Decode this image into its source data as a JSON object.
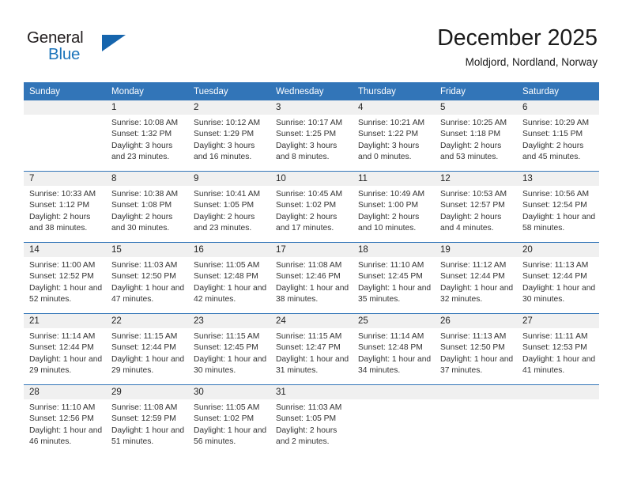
{
  "brand": {
    "name_part1": "General",
    "name_part2": "Blue",
    "accent_color": "#1c74bb",
    "triangle_color": "#1665ad"
  },
  "header": {
    "title": "December 2025",
    "subtitle": "Moldjord, Nordland, Norway"
  },
  "calendar": {
    "header_bg": "#3275b8",
    "weekday_headers": [
      "Sunday",
      "Monday",
      "Tuesday",
      "Wednesday",
      "Thursday",
      "Friday",
      "Saturday"
    ],
    "weeks": [
      [
        {
          "day": "",
          "lines": []
        },
        {
          "day": "1",
          "lines": [
            "Sunrise: 10:08 AM",
            "Sunset: 1:32 PM",
            "Daylight: 3 hours",
            "and 23 minutes."
          ]
        },
        {
          "day": "2",
          "lines": [
            "Sunrise: 10:12 AM",
            "Sunset: 1:29 PM",
            "Daylight: 3 hours",
            "and 16 minutes."
          ]
        },
        {
          "day": "3",
          "lines": [
            "Sunrise: 10:17 AM",
            "Sunset: 1:25 PM",
            "Daylight: 3 hours",
            "and 8 minutes."
          ]
        },
        {
          "day": "4",
          "lines": [
            "Sunrise: 10:21 AM",
            "Sunset: 1:22 PM",
            "Daylight: 3 hours",
            "and 0 minutes."
          ]
        },
        {
          "day": "5",
          "lines": [
            "Sunrise: 10:25 AM",
            "Sunset: 1:18 PM",
            "Daylight: 2 hours",
            "and 53 minutes."
          ]
        },
        {
          "day": "6",
          "lines": [
            "Sunrise: 10:29 AM",
            "Sunset: 1:15 PM",
            "Daylight: 2 hours",
            "and 45 minutes."
          ]
        }
      ],
      [
        {
          "day": "7",
          "lines": [
            "Sunrise: 10:33 AM",
            "Sunset: 1:12 PM",
            "Daylight: 2 hours",
            "and 38 minutes."
          ]
        },
        {
          "day": "8",
          "lines": [
            "Sunrise: 10:38 AM",
            "Sunset: 1:08 PM",
            "Daylight: 2 hours",
            "and 30 minutes."
          ]
        },
        {
          "day": "9",
          "lines": [
            "Sunrise: 10:41 AM",
            "Sunset: 1:05 PM",
            "Daylight: 2 hours",
            "and 23 minutes."
          ]
        },
        {
          "day": "10",
          "lines": [
            "Sunrise: 10:45 AM",
            "Sunset: 1:02 PM",
            "Daylight: 2 hours",
            "and 17 minutes."
          ]
        },
        {
          "day": "11",
          "lines": [
            "Sunrise: 10:49 AM",
            "Sunset: 1:00 PM",
            "Daylight: 2 hours",
            "and 10 minutes."
          ]
        },
        {
          "day": "12",
          "lines": [
            "Sunrise: 10:53 AM",
            "Sunset: 12:57 PM",
            "Daylight: 2 hours",
            "and 4 minutes."
          ]
        },
        {
          "day": "13",
          "lines": [
            "Sunrise: 10:56 AM",
            "Sunset: 12:54 PM",
            "Daylight: 1 hour and",
            "58 minutes."
          ]
        }
      ],
      [
        {
          "day": "14",
          "lines": [
            "Sunrise: 11:00 AM",
            "Sunset: 12:52 PM",
            "Daylight: 1 hour and",
            "52 minutes."
          ]
        },
        {
          "day": "15",
          "lines": [
            "Sunrise: 11:03 AM",
            "Sunset: 12:50 PM",
            "Daylight: 1 hour and",
            "47 minutes."
          ]
        },
        {
          "day": "16",
          "lines": [
            "Sunrise: 11:05 AM",
            "Sunset: 12:48 PM",
            "Daylight: 1 hour and",
            "42 minutes."
          ]
        },
        {
          "day": "17",
          "lines": [
            "Sunrise: 11:08 AM",
            "Sunset: 12:46 PM",
            "Daylight: 1 hour and",
            "38 minutes."
          ]
        },
        {
          "day": "18",
          "lines": [
            "Sunrise: 11:10 AM",
            "Sunset: 12:45 PM",
            "Daylight: 1 hour and",
            "35 minutes."
          ]
        },
        {
          "day": "19",
          "lines": [
            "Sunrise: 11:12 AM",
            "Sunset: 12:44 PM",
            "Daylight: 1 hour and",
            "32 minutes."
          ]
        },
        {
          "day": "20",
          "lines": [
            "Sunrise: 11:13 AM",
            "Sunset: 12:44 PM",
            "Daylight: 1 hour and",
            "30 minutes."
          ]
        }
      ],
      [
        {
          "day": "21",
          "lines": [
            "Sunrise: 11:14 AM",
            "Sunset: 12:44 PM",
            "Daylight: 1 hour and",
            "29 minutes."
          ]
        },
        {
          "day": "22",
          "lines": [
            "Sunrise: 11:15 AM",
            "Sunset: 12:44 PM",
            "Daylight: 1 hour and",
            "29 minutes."
          ]
        },
        {
          "day": "23",
          "lines": [
            "Sunrise: 11:15 AM",
            "Sunset: 12:45 PM",
            "Daylight: 1 hour and",
            "30 minutes."
          ]
        },
        {
          "day": "24",
          "lines": [
            "Sunrise: 11:15 AM",
            "Sunset: 12:47 PM",
            "Daylight: 1 hour and",
            "31 minutes."
          ]
        },
        {
          "day": "25",
          "lines": [
            "Sunrise: 11:14 AM",
            "Sunset: 12:48 PM",
            "Daylight: 1 hour and",
            "34 minutes."
          ]
        },
        {
          "day": "26",
          "lines": [
            "Sunrise: 11:13 AM",
            "Sunset: 12:50 PM",
            "Daylight: 1 hour and",
            "37 minutes."
          ]
        },
        {
          "day": "27",
          "lines": [
            "Sunrise: 11:11 AM",
            "Sunset: 12:53 PM",
            "Daylight: 1 hour and",
            "41 minutes."
          ]
        }
      ],
      [
        {
          "day": "28",
          "lines": [
            "Sunrise: 11:10 AM",
            "Sunset: 12:56 PM",
            "Daylight: 1 hour and",
            "46 minutes."
          ]
        },
        {
          "day": "29",
          "lines": [
            "Sunrise: 11:08 AM",
            "Sunset: 12:59 PM",
            "Daylight: 1 hour and",
            "51 minutes."
          ]
        },
        {
          "day": "30",
          "lines": [
            "Sunrise: 11:05 AM",
            "Sunset: 1:02 PM",
            "Daylight: 1 hour and",
            "56 minutes."
          ]
        },
        {
          "day": "31",
          "lines": [
            "Sunrise: 11:03 AM",
            "Sunset: 1:05 PM",
            "Daylight: 2 hours",
            "and 2 minutes."
          ]
        },
        {
          "day": "",
          "lines": []
        },
        {
          "day": "",
          "lines": []
        },
        {
          "day": "",
          "lines": []
        }
      ]
    ]
  }
}
